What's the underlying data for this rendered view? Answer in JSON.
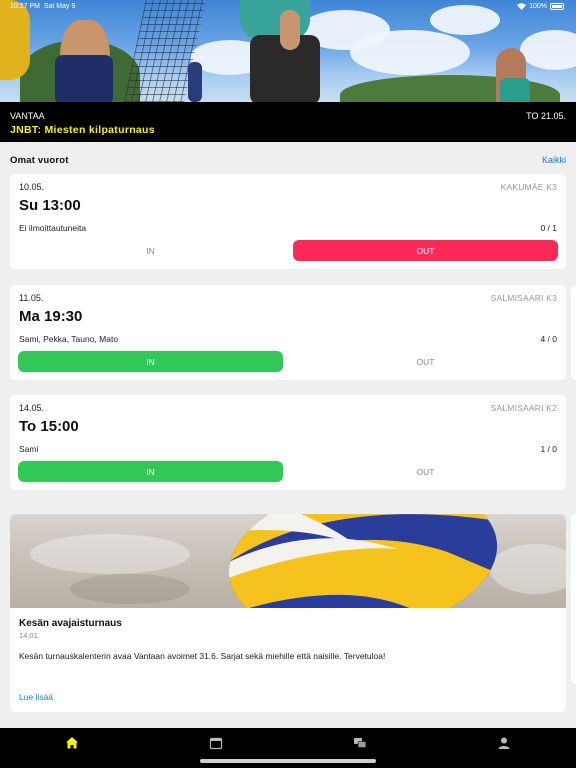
{
  "status_bar": {
    "time": "10:27 PM",
    "date": "Sat May 9",
    "battery": "100%"
  },
  "tournament": {
    "location": "VANTAA",
    "name": "JNBT: Miesten kilpaturnaus",
    "date": "TO 21.05."
  },
  "shifts": {
    "title": "Omat vuorot",
    "all_link": "Kaikki",
    "items": [
      {
        "date": "10.05.",
        "court": "KAKUMÄE K3",
        "time": "Su 13:00",
        "players": "Ei ilmoittautuneita",
        "count": "0 / 1",
        "in_label": "IN",
        "out_label": "OUT",
        "selected": "out"
      },
      {
        "date": "11.05.",
        "court": "SALMISAARI K3",
        "time": "Ma 19:30",
        "players": "Sami, Pekka, Tauno, Mato",
        "count": "4 / 0",
        "in_label": "IN",
        "out_label": "OUT",
        "selected": "in"
      },
      {
        "date": "14.05.",
        "court": "SALMISAARI K2",
        "time": "To 15:00",
        "players": "Sami",
        "count": "1 / 0",
        "in_label": "IN",
        "out_label": "OUT",
        "selected": "in"
      }
    ]
  },
  "news": {
    "title": "Kesän avajaisturnaus",
    "date": "14.01.",
    "body": "Kesän turnauskalenterin avaa Vantaan avoimet 31.6. Sarjat sekä miehille että naisille. Tervetuloa!",
    "link": "Lue lisää"
  },
  "tabs": [
    {
      "icon": "home-icon",
      "active": true
    },
    {
      "icon": "calendar-icon",
      "active": false
    },
    {
      "icon": "chat-icon",
      "active": false
    },
    {
      "icon": "profile-icon",
      "active": false
    }
  ],
  "colors": {
    "accent_yellow": "#fff200",
    "in_green": "#33c758",
    "out_red": "#fd2a59",
    "link_blue": "#1a7fe0"
  }
}
